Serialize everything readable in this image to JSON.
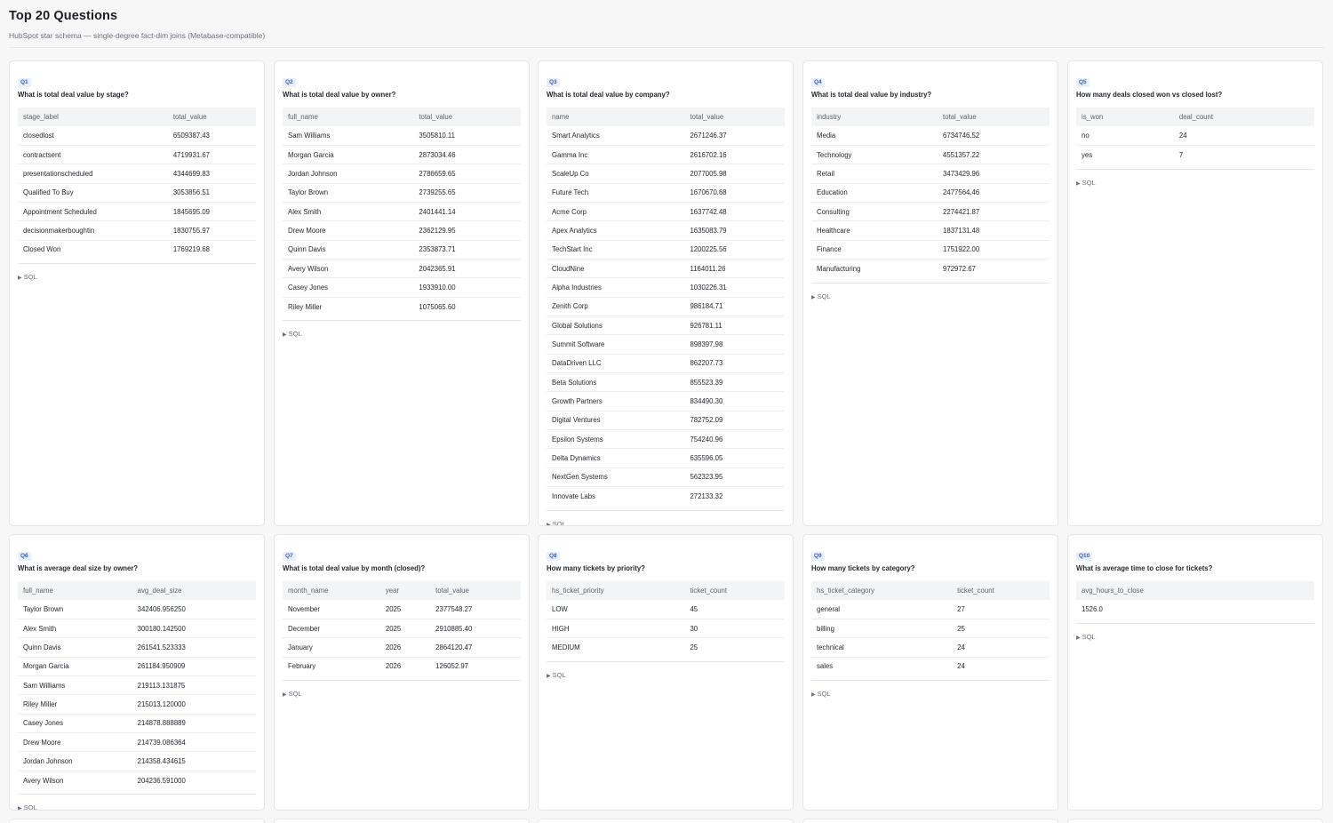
{
  "page": {
    "title": "Top 20 Questions",
    "subtitle": "HubSpot star schema — single-degree fact-dim joins (Metabase-compatible)"
  },
  "sql_label": "SQL",
  "cards": [
    {
      "badge": "Q1",
      "question": "What is total deal value by stage?",
      "columns": [
        "stage_label",
        "total_value"
      ],
      "rows": [
        [
          "closedlost",
          "6509387.43"
        ],
        [
          "contractsent",
          "4719931.67"
        ],
        [
          "presentationscheduled",
          "4344699.83"
        ],
        [
          "Qualified To Buy",
          "3053856.51"
        ],
        [
          "Appointment Scheduled",
          "1845695.09"
        ],
        [
          "decisionmakerboughtin",
          "1830755.97"
        ],
        [
          "Closed Won",
          "1769219.68"
        ]
      ]
    },
    {
      "badge": "Q2",
      "question": "What is total deal value by owner?",
      "columns": [
        "full_name",
        "total_value"
      ],
      "rows": [
        [
          "Sam Williams",
          "3505810.11"
        ],
        [
          "Morgan Garcia",
          "2873034.46"
        ],
        [
          "Jordan Johnson",
          "2786659.65"
        ],
        [
          "Taylor Brown",
          "2739255.65"
        ],
        [
          "Alex Smith",
          "2401441.14"
        ],
        [
          "Drew Moore",
          "2362129.95"
        ],
        [
          "Quinn Davis",
          "2353873.71"
        ],
        [
          "Avery Wilson",
          "2042365.91"
        ],
        [
          "Casey Jones",
          "1933910.00"
        ],
        [
          "Riley Miller",
          "1075065.60"
        ]
      ]
    },
    {
      "badge": "Q3",
      "question": "What is total deal value by company?",
      "columns": [
        "name",
        "total_value"
      ],
      "rows": [
        [
          "Smart Analytics",
          "2671246.37"
        ],
        [
          "Gamma Inc",
          "2616702.16"
        ],
        [
          "ScaleUp Co",
          "2077005.98"
        ],
        [
          "Future Tech",
          "1670670.68"
        ],
        [
          "Acme Corp",
          "1637742.48"
        ],
        [
          "Apex Analytics",
          "1635083.79"
        ],
        [
          "TechStart Inc",
          "1200225.56"
        ],
        [
          "CloudNine",
          "1164011.26"
        ],
        [
          "Alpha Industries",
          "1030226.31"
        ],
        [
          "Zenith Corp",
          "986184.71"
        ],
        [
          "Global Solutions",
          "926781.11"
        ],
        [
          "Summit Software",
          "898397.98"
        ],
        [
          "DataDriven LLC",
          "862207.73"
        ],
        [
          "Beta Solutions",
          "855523.39"
        ],
        [
          "Growth Partners",
          "834490.30"
        ],
        [
          "Digital Ventures",
          "782752.09"
        ],
        [
          "Epsilon Systems",
          "754240.96"
        ],
        [
          "Delta Dynamics",
          "635596.05"
        ],
        [
          "NextGen Systems",
          "562323.95"
        ],
        [
          "Innovate Labs",
          "272133.32"
        ]
      ]
    },
    {
      "badge": "Q4",
      "question": "What is total deal value by industry?",
      "columns": [
        "industry",
        "total_value"
      ],
      "rows": [
        [
          "Media",
          "6734746.52"
        ],
        [
          "Technology",
          "4551357.22"
        ],
        [
          "Retail",
          "3473429.96"
        ],
        [
          "Education",
          "2477564.46"
        ],
        [
          "Consulting",
          "2274421.87"
        ],
        [
          "Healthcare",
          "1837131.48"
        ],
        [
          "Finance",
          "1751922.00"
        ],
        [
          "Manufacturing",
          "972972.67"
        ]
      ]
    },
    {
      "badge": "Q5",
      "question": "How many deals closed won vs closed lost?",
      "columns": [
        "is_won",
        "deal_count"
      ],
      "rows": [
        [
          "no",
          "24"
        ],
        [
          "yes",
          "7"
        ]
      ]
    },
    {
      "badge": "Q6",
      "question": "What is average deal size by owner?",
      "columns": [
        "full_name",
        "avg_deal_size"
      ],
      "rows": [
        [
          "Taylor Brown",
          "342406.956250"
        ],
        [
          "Alex Smith",
          "300180.142500"
        ],
        [
          "Quinn Davis",
          "261541.523333"
        ],
        [
          "Morgan Garcia",
          "261184.950909"
        ],
        [
          "Sam Williams",
          "219113.131875"
        ],
        [
          "Riley Miller",
          "215013.120000"
        ],
        [
          "Casey Jones",
          "214878.888889"
        ],
        [
          "Drew Moore",
          "214739.086364"
        ],
        [
          "Jordan Johnson",
          "214358.434615"
        ],
        [
          "Avery Wilson",
          "204236.591000"
        ]
      ]
    },
    {
      "badge": "Q7",
      "question": "What is total deal value by month (closed)?",
      "columns": [
        "month_name",
        "year",
        "total_value"
      ],
      "rows": [
        [
          "November",
          "2025",
          "2377548.27"
        ],
        [
          "December",
          "2025",
          "2910885.40"
        ],
        [
          "January",
          "2026",
          "2864120.47"
        ],
        [
          "February",
          "2026",
          "126052.97"
        ]
      ]
    },
    {
      "badge": "Q8",
      "question": "How many tickets by priority?",
      "columns": [
        "hs_ticket_priority",
        "ticket_count"
      ],
      "rows": [
        [
          "LOW",
          "45"
        ],
        [
          "HIGH",
          "30"
        ],
        [
          "MEDIUM",
          "25"
        ]
      ]
    },
    {
      "badge": "Q9",
      "question": "How many tickets by category?",
      "columns": [
        "hs_ticket_category",
        "ticket_count"
      ],
      "rows": [
        [
          "general",
          "27"
        ],
        [
          "billing",
          "25"
        ],
        [
          "technical",
          "24"
        ],
        [
          "sales",
          "24"
        ]
      ]
    },
    {
      "badge": "Q10",
      "question": "What is average time to close for tickets?",
      "columns": [
        "avg_hours_to_close"
      ],
      "rows": [
        [
          "1526.0"
        ]
      ]
    }
  ]
}
